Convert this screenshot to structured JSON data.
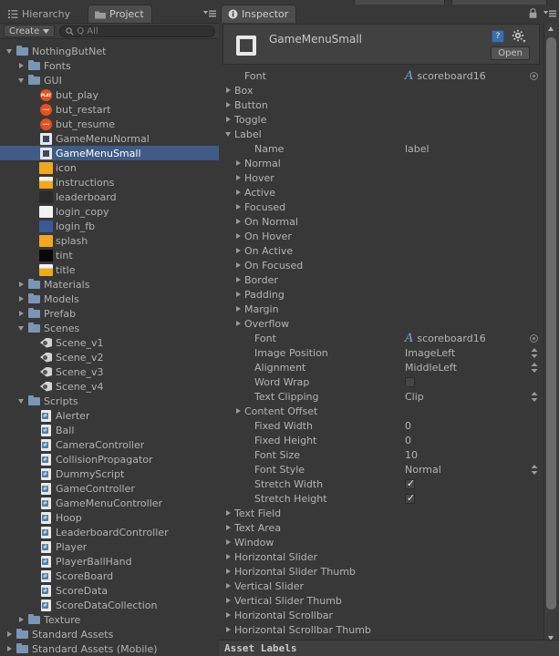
{
  "window": {
    "background": "#383838",
    "selection_color": "#3e5c84",
    "accent_blue": "#7ba3d0"
  },
  "left_panel": {
    "tabs": [
      {
        "label": "Hierarchy",
        "icon": "hierarchy-icon",
        "active": false
      },
      {
        "label": "Project",
        "icon": "folder-icon",
        "active": true
      }
    ],
    "toolbar": {
      "create_label": "Create",
      "search_placeholder": "Q All",
      "search_value": ""
    },
    "tree": [
      {
        "label": "NothingButNet",
        "indent": 0,
        "arrow": "open",
        "icon": "folder"
      },
      {
        "label": "Fonts",
        "indent": 1,
        "arrow": "closed",
        "icon": "folder"
      },
      {
        "label": "GUI",
        "indent": 1,
        "arrow": "open",
        "icon": "folder"
      },
      {
        "label": "but_play",
        "indent": 2,
        "arrow": "none",
        "icon": "ball",
        "badge": "PLAY"
      },
      {
        "label": "but_restart",
        "indent": 2,
        "arrow": "none",
        "icon": "ball",
        "badge": "•••"
      },
      {
        "label": "but_resume",
        "indent": 2,
        "arrow": "none",
        "icon": "ball",
        "badge": "•••"
      },
      {
        "label": "GameMenuNormal",
        "indent": 2,
        "arrow": "none",
        "icon": "skin"
      },
      {
        "label": "GameMenuSmall",
        "indent": 2,
        "arrow": "none",
        "icon": "skin",
        "selected": true
      },
      {
        "label": "icon",
        "indent": 2,
        "arrow": "none",
        "icon": "gold"
      },
      {
        "label": "instructions",
        "indent": 2,
        "arrow": "none",
        "icon": "halfgold"
      },
      {
        "label": "leaderboard",
        "indent": 2,
        "arrow": "none",
        "icon": "dark"
      },
      {
        "label": "login_copy",
        "indent": 2,
        "arrow": "none",
        "icon": "white"
      },
      {
        "label": "login_fb",
        "indent": 2,
        "arrow": "none",
        "icon": "blue"
      },
      {
        "label": "splash",
        "indent": 2,
        "arrow": "none",
        "icon": "gold"
      },
      {
        "label": "tint",
        "indent": 2,
        "arrow": "none",
        "icon": "black"
      },
      {
        "label": "title",
        "indent": 2,
        "arrow": "none",
        "icon": "halfgold"
      },
      {
        "label": "Materials",
        "indent": 1,
        "arrow": "closed",
        "icon": "folder"
      },
      {
        "label": "Models",
        "indent": 1,
        "arrow": "closed",
        "icon": "folder"
      },
      {
        "label": "Prefab",
        "indent": 1,
        "arrow": "closed",
        "icon": "folder"
      },
      {
        "label": "Scenes",
        "indent": 1,
        "arrow": "open",
        "icon": "folder"
      },
      {
        "label": "Scene_v1",
        "indent": 2,
        "arrow": "none",
        "icon": "scene"
      },
      {
        "label": "Scene_v2",
        "indent": 2,
        "arrow": "none",
        "icon": "scene"
      },
      {
        "label": "Scene_v3",
        "indent": 2,
        "arrow": "none",
        "icon": "scene"
      },
      {
        "label": "Scene_v4",
        "indent": 2,
        "arrow": "none",
        "icon": "scene"
      },
      {
        "label": "Scripts",
        "indent": 1,
        "arrow": "open",
        "icon": "folder"
      },
      {
        "label": "Alerter",
        "indent": 2,
        "arrow": "none",
        "icon": "script"
      },
      {
        "label": "Ball",
        "indent": 2,
        "arrow": "none",
        "icon": "script"
      },
      {
        "label": "CameraController",
        "indent": 2,
        "arrow": "none",
        "icon": "script"
      },
      {
        "label": "CollisionPropagator",
        "indent": 2,
        "arrow": "none",
        "icon": "script"
      },
      {
        "label": "DummyScript",
        "indent": 2,
        "arrow": "none",
        "icon": "script"
      },
      {
        "label": "GameController",
        "indent": 2,
        "arrow": "none",
        "icon": "script"
      },
      {
        "label": "GameMenuController",
        "indent": 2,
        "arrow": "none",
        "icon": "script"
      },
      {
        "label": "Hoop",
        "indent": 2,
        "arrow": "none",
        "icon": "script"
      },
      {
        "label": "LeaderboardController",
        "indent": 2,
        "arrow": "none",
        "icon": "script"
      },
      {
        "label": "Player",
        "indent": 2,
        "arrow": "none",
        "icon": "script"
      },
      {
        "label": "PlayerBallHand",
        "indent": 2,
        "arrow": "none",
        "icon": "script"
      },
      {
        "label": "ScoreBoard",
        "indent": 2,
        "arrow": "none",
        "icon": "script"
      },
      {
        "label": "ScoreData",
        "indent": 2,
        "arrow": "none",
        "icon": "script"
      },
      {
        "label": "ScoreDataCollection",
        "indent": 2,
        "arrow": "none",
        "icon": "script"
      },
      {
        "label": "Texture",
        "indent": 1,
        "arrow": "closed",
        "icon": "folder"
      },
      {
        "label": "Standard Assets",
        "indent": 0,
        "arrow": "closed",
        "icon": "folder"
      },
      {
        "label": "Standard Assets (Mobile)",
        "indent": 0,
        "arrow": "closed",
        "icon": "folder"
      }
    ]
  },
  "inspector": {
    "tab_label": "Inspector",
    "tab_icon": "info-icon",
    "lock_icon": "lock-icon",
    "menu_icon": "tab-menu-icon",
    "header": {
      "title": "GameMenuSmall",
      "icon": "guiskin-icon",
      "help_icon": "help-book-icon",
      "gear_icon": "gear-icon",
      "open_button": "Open"
    },
    "rows": [
      {
        "name": "Font",
        "indent": 1,
        "arrow": "none",
        "value": "scoreboard16",
        "type": "object"
      },
      {
        "name": "Box",
        "indent": 0,
        "arrow": "closed",
        "value": "",
        "type": "group"
      },
      {
        "name": "Button",
        "indent": 0,
        "arrow": "closed",
        "value": "",
        "type": "group"
      },
      {
        "name": "Toggle",
        "indent": 0,
        "arrow": "closed",
        "value": "",
        "type": "group"
      },
      {
        "name": "Label",
        "indent": 0,
        "arrow": "open",
        "value": "",
        "type": "group"
      },
      {
        "name": "Name",
        "indent": 2,
        "arrow": "none",
        "value": "label",
        "type": "text"
      },
      {
        "name": "Normal",
        "indent": 1,
        "arrow": "closed",
        "value": "",
        "type": "group"
      },
      {
        "name": "Hover",
        "indent": 1,
        "arrow": "closed",
        "value": "",
        "type": "group"
      },
      {
        "name": "Active",
        "indent": 1,
        "arrow": "closed",
        "value": "",
        "type": "group"
      },
      {
        "name": "Focused",
        "indent": 1,
        "arrow": "closed",
        "value": "",
        "type": "group"
      },
      {
        "name": "On Normal",
        "indent": 1,
        "arrow": "closed",
        "value": "",
        "type": "group"
      },
      {
        "name": "On Hover",
        "indent": 1,
        "arrow": "closed",
        "value": "",
        "type": "group"
      },
      {
        "name": "On Active",
        "indent": 1,
        "arrow": "closed",
        "value": "",
        "type": "group"
      },
      {
        "name": "On Focused",
        "indent": 1,
        "arrow": "closed",
        "value": "",
        "type": "group"
      },
      {
        "name": "Border",
        "indent": 1,
        "arrow": "closed",
        "value": "",
        "type": "group"
      },
      {
        "name": "Padding",
        "indent": 1,
        "arrow": "closed",
        "value": "",
        "type": "group"
      },
      {
        "name": "Margin",
        "indent": 1,
        "arrow": "closed",
        "value": "",
        "type": "group"
      },
      {
        "name": "Overflow",
        "indent": 1,
        "arrow": "closed",
        "value": "",
        "type": "group"
      },
      {
        "name": "Font",
        "indent": 2,
        "arrow": "none",
        "value": "scoreboard16",
        "type": "object"
      },
      {
        "name": "Image Position",
        "indent": 2,
        "arrow": "none",
        "value": "ImageLeft",
        "type": "enum"
      },
      {
        "name": "Alignment",
        "indent": 2,
        "arrow": "none",
        "value": "MiddleLeft",
        "type": "enum"
      },
      {
        "name": "Word Wrap",
        "indent": 2,
        "arrow": "none",
        "value": false,
        "type": "bool"
      },
      {
        "name": "Text Clipping",
        "indent": 2,
        "arrow": "none",
        "value": "Clip",
        "type": "enum"
      },
      {
        "name": "Content Offset",
        "indent": 1,
        "arrow": "closed",
        "value": "",
        "type": "group"
      },
      {
        "name": "Fixed Width",
        "indent": 2,
        "arrow": "none",
        "value": "0",
        "type": "number"
      },
      {
        "name": "Fixed Height",
        "indent": 2,
        "arrow": "none",
        "value": "0",
        "type": "number"
      },
      {
        "name": "Font Size",
        "indent": 2,
        "arrow": "none",
        "value": "10",
        "type": "number"
      },
      {
        "name": "Font Style",
        "indent": 2,
        "arrow": "none",
        "value": "Normal",
        "type": "enum"
      },
      {
        "name": "Stretch Width",
        "indent": 2,
        "arrow": "none",
        "value": true,
        "type": "bool"
      },
      {
        "name": "Stretch Height",
        "indent": 2,
        "arrow": "none",
        "value": true,
        "type": "bool"
      },
      {
        "name": "Text Field",
        "indent": 0,
        "arrow": "closed",
        "value": "",
        "type": "group"
      },
      {
        "name": "Text Area",
        "indent": 0,
        "arrow": "closed",
        "value": "",
        "type": "group"
      },
      {
        "name": "Window",
        "indent": 0,
        "arrow": "closed",
        "value": "",
        "type": "group"
      },
      {
        "name": "Horizontal Slider",
        "indent": 0,
        "arrow": "closed",
        "value": "",
        "type": "group"
      },
      {
        "name": "Horizontal Slider Thumb",
        "indent": 0,
        "arrow": "closed",
        "value": "",
        "type": "group"
      },
      {
        "name": "Vertical Slider",
        "indent": 0,
        "arrow": "closed",
        "value": "",
        "type": "group"
      },
      {
        "name": "Vertical Slider Thumb",
        "indent": 0,
        "arrow": "closed",
        "value": "",
        "type": "group"
      },
      {
        "name": "Horizontal Scrollbar",
        "indent": 0,
        "arrow": "closed",
        "value": "",
        "type": "group"
      },
      {
        "name": "Horizontal Scrollbar Thumb",
        "indent": 0,
        "arrow": "closed",
        "value": "",
        "type": "group"
      }
    ],
    "footer": {
      "asset_labels": "Asset Labels"
    },
    "scrollbar": {
      "up_icon": "scroll-up-icon",
      "down_icon": "scroll-down-icon"
    }
  }
}
